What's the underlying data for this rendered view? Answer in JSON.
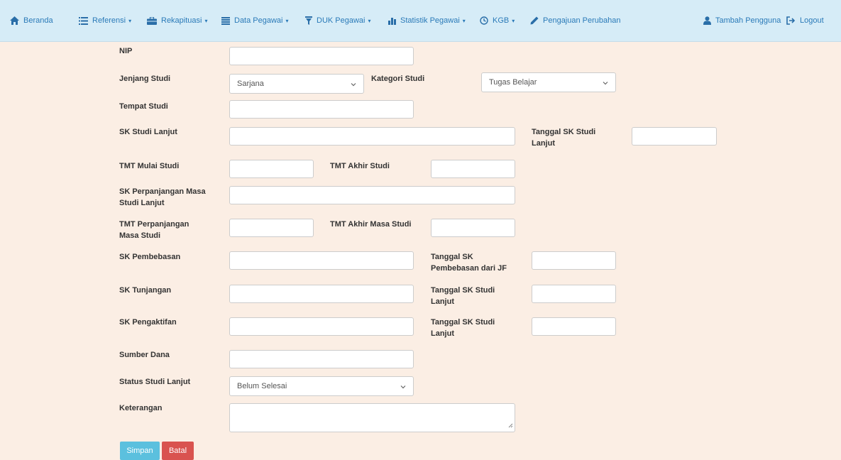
{
  "nav": {
    "beranda": "Beranda",
    "referensi": "Referensi",
    "rekapituasi": "Rekapituasi",
    "data_pegawai": "Data Pegawai",
    "duk_pegawai": "DUK Pegawai",
    "statistik_pegawai": "Statistik Pegawai",
    "kgb": "KGB",
    "pengajuan_perubahan": "Pengajuan Perubahan",
    "tambah_pengguna": "Tambah Pengguna",
    "logout": "Logout"
  },
  "form": {
    "nip": "NIP",
    "jenjang_studi": "Jenjang Studi",
    "jenjang_studi_value": "Sarjana",
    "kategori_studi": "Kategori Studi",
    "kategori_studi_value": "Tugas Belajar",
    "tempat_studi": "Tempat Studi",
    "sk_studi_lanjut": "SK Studi Lanjut",
    "tanggal_sk_studi_lanjut": "Tanggal SK Studi Lanjut",
    "tmt_mulai_studi": "TMT Mulai Studi",
    "tmt_akhir_studi": "TMT Akhir Studi",
    "sk_perpanjangan": "SK Perpanjangan Masa Studi Lanjut",
    "tmt_perpanjangan": "TMT Perpanjangan Masa Studi",
    "tmt_akhir_masa_studi": "TMT Akhir Masa Studi",
    "sk_pembebasan": "SK Pembebasan",
    "tanggal_sk_pembebasan": "Tanggal SK Pembebasan dari JF",
    "sk_tunjangan": "SK Tunjangan",
    "tanggal_sk_tunjangan": "Tanggal SK Studi Lanjut",
    "sk_pengaktifan": "SK Pengaktifan",
    "tanggal_sk_pengaktifan": "Tanggal SK Studi Lanjut",
    "sumber_dana": "Sumber Dana",
    "status_studi_lanjut": "Status Studi Lanjut",
    "status_studi_lanjut_value": "Belum Selesai",
    "keterangan": "Keterangan"
  },
  "buttons": {
    "simpan": "Simpan",
    "batal": "Batal"
  },
  "colors": {
    "simpan": "#5bc0de",
    "batal": "#d9534f",
    "nav_text": "#2a7ab8",
    "page_bg": "#fbeee4",
    "nav_bg": "#d6ecf7"
  }
}
